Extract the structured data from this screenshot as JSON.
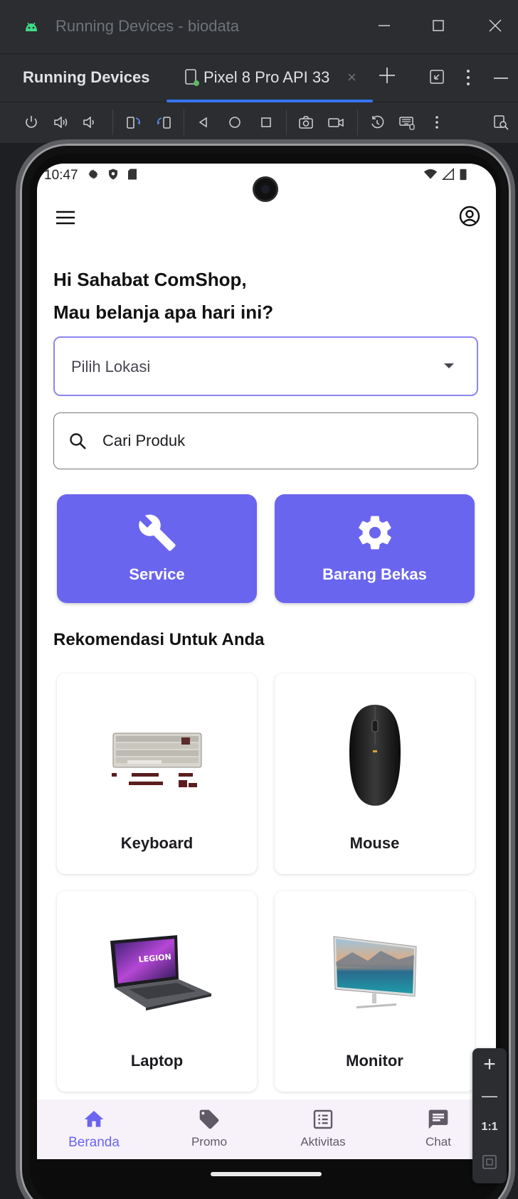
{
  "window": {
    "title": "Running Devices - biodata"
  },
  "tool_window": {
    "label": "Running Devices",
    "device_tab": "Pixel 8 Pro API 33",
    "tab_close": "×"
  },
  "toolbar": {
    "icons": [
      "power-icon",
      "volume-up-icon",
      "volume-down-icon",
      "rotate-left-icon",
      "rotate-right-icon",
      "back-icon",
      "home-icon",
      "overview-icon",
      "screenshot-icon",
      "screen-record-icon",
      "snapshot-icon",
      "keyboard-icon",
      "more-icon",
      "device-explorer-icon"
    ]
  },
  "status_bar": {
    "time": "10:47"
  },
  "app": {
    "greeting_line1": "Hi Sahabat ComShop,",
    "greeting_line2": "Mau belanja apa hari ini?",
    "location_placeholder": "Pilih Lokasi",
    "search_placeholder": "Cari Produk",
    "quick_actions": [
      {
        "label": "Service",
        "icon": "wrench-icon"
      },
      {
        "label": "Barang Bekas",
        "icon": "gear-icon"
      }
    ],
    "section_title": "Rekomendasi Untuk Anda",
    "products": [
      {
        "name": "Keyboard"
      },
      {
        "name": "Mouse"
      },
      {
        "name": "Laptop"
      },
      {
        "name": "Monitor"
      }
    ],
    "laptop_brand_text": "LEGION"
  },
  "bottom_nav": [
    {
      "label": "Beranda",
      "icon": "home-icon",
      "active": true
    },
    {
      "label": "Promo",
      "icon": "tag-icon",
      "active": false
    },
    {
      "label": "Aktivitas",
      "icon": "list-icon",
      "active": false
    },
    {
      "label": "Chat",
      "icon": "chat-icon",
      "active": false
    }
  ],
  "zoom_controls": {
    "zoom_in": "+",
    "zoom_out": "—",
    "actual_size": "1:1"
  },
  "colors": {
    "accent": "#6a65ef",
    "ide_background": "#2b2d30",
    "tab_underline": "#3574f0",
    "nav_background": "#f7f2fa"
  }
}
